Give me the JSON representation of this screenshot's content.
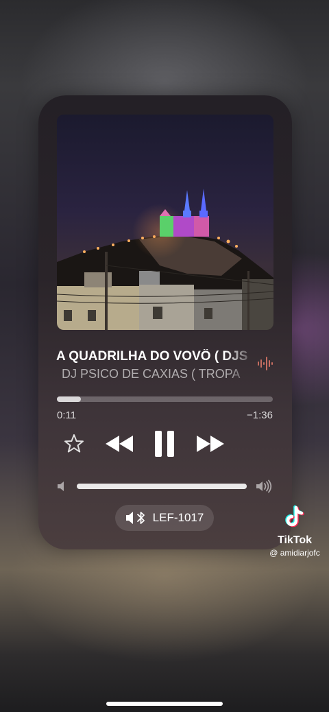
{
  "player": {
    "track_title": "A QUADRILHA DO VOVÔ ( DJS",
    "artist": "DJ PSICO DE CAXIAS ( TROPA",
    "elapsed": "0:11",
    "remaining": "−1:36",
    "progress_fraction": 0.11,
    "volume_fraction": 1.0,
    "output_device": "LEF-1017"
  },
  "watermark": {
    "brand": "TikTok",
    "handle": "@ amidiarjofc"
  },
  "icons": {
    "favorite": "star-icon",
    "previous": "rewind-icon",
    "play_state": "pause-icon",
    "next": "fast-forward-icon",
    "volume_min": "speaker-low-icon",
    "volume_max": "speaker-high-icon",
    "device": "bluetooth-speaker-icon",
    "now_playing": "waveform-icon"
  },
  "colors": {
    "text_primary": "#ffffff",
    "tiktok_cyan": "#25f4ee",
    "tiktok_red": "#fe2c55"
  }
}
